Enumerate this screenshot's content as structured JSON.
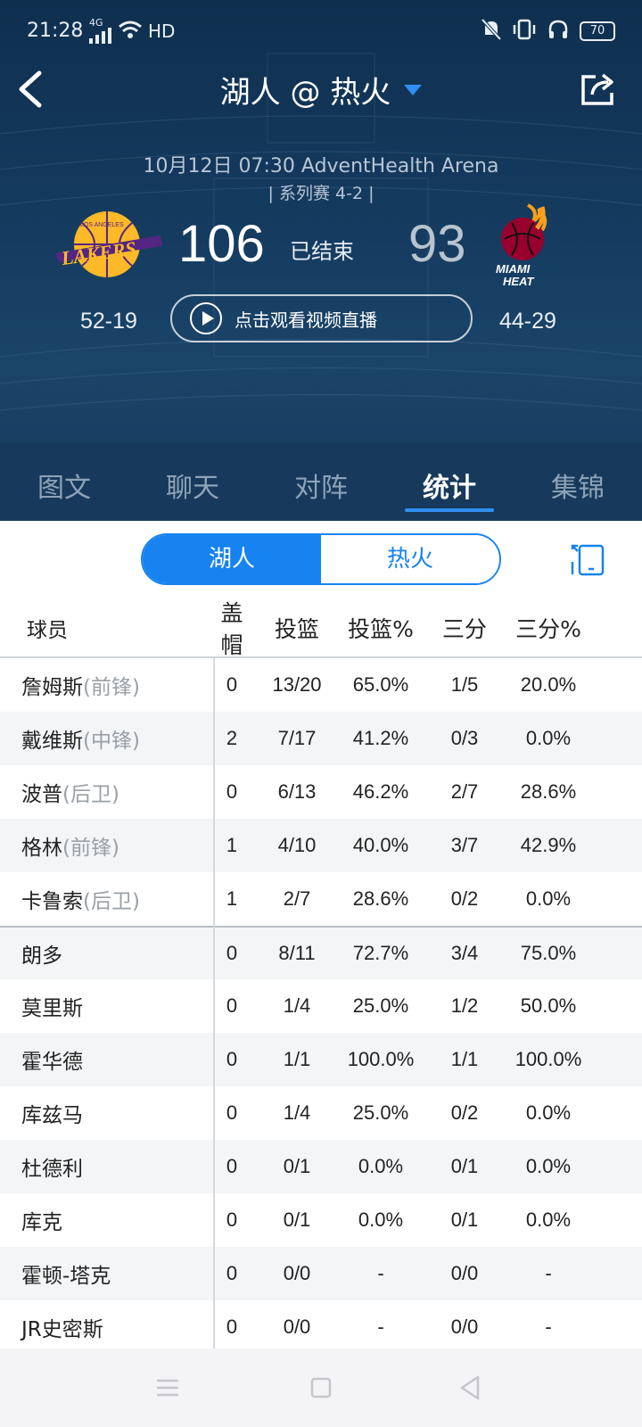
{
  "status_bar": {
    "time": "21:28",
    "network": "4G",
    "hd": "HD",
    "battery": "70"
  },
  "header": {
    "title": "湖人 @ 热火",
    "game_info": "10月12日 07:30 AdventHealth Arena",
    "series_info": "| 系列赛 4-2 |",
    "home": {
      "score": "106",
      "record": "52-19",
      "logo_text_top": "LOS ANGELES",
      "logo_text": "LAKERS"
    },
    "away": {
      "score": "93",
      "record": "44-29",
      "logo_text_1": "MIAMI",
      "logo_text_2": "HEAT"
    },
    "status": "已结束",
    "watch_label": "点击观看视频直播"
  },
  "tabs": [
    {
      "label": "图文"
    },
    {
      "label": "聊天"
    },
    {
      "label": "对阵"
    },
    {
      "label": "统计"
    },
    {
      "label": "集锦"
    }
  ],
  "active_tab": "统计",
  "team_toggle": {
    "team_a": "湖人",
    "team_b": "热火",
    "selected": "湖人"
  },
  "table": {
    "columns": [
      "球员",
      "盖帽",
      "投篮",
      "投篮%",
      "三分",
      "三分%"
    ],
    "rows": [
      {
        "name": "詹姆斯",
        "pos": "(前锋)",
        "blk": "0",
        "fg": "13/20",
        "fgp": "65.0%",
        "tp": "1/5",
        "tpp": "20.0%"
      },
      {
        "name": "戴维斯",
        "pos": "(中锋)",
        "blk": "2",
        "fg": "7/17",
        "fgp": "41.2%",
        "tp": "0/3",
        "tpp": "0.0%"
      },
      {
        "name": "波普",
        "pos": "(后卫)",
        "blk": "0",
        "fg": "6/13",
        "fgp": "46.2%",
        "tp": "2/7",
        "tpp": "28.6%"
      },
      {
        "name": "格林",
        "pos": "(前锋)",
        "blk": "1",
        "fg": "4/10",
        "fgp": "40.0%",
        "tp": "3/7",
        "tpp": "42.9%"
      },
      {
        "name": "卡鲁索",
        "pos": "(后卫)",
        "blk": "1",
        "fg": "2/7",
        "fgp": "28.6%",
        "tp": "0/2",
        "tpp": "0.0%"
      },
      {
        "name": "朗多",
        "pos": "",
        "blk": "0",
        "fg": "8/11",
        "fgp": "72.7%",
        "tp": "3/4",
        "tpp": "75.0%"
      },
      {
        "name": "莫里斯",
        "pos": "",
        "blk": "0",
        "fg": "1/4",
        "fgp": "25.0%",
        "tp": "1/2",
        "tpp": "50.0%"
      },
      {
        "name": "霍华德",
        "pos": "",
        "blk": "0",
        "fg": "1/1",
        "fgp": "100.0%",
        "tp": "1/1",
        "tpp": "100.0%"
      },
      {
        "name": "库兹马",
        "pos": "",
        "blk": "0",
        "fg": "1/4",
        "fgp": "25.0%",
        "tp": "0/2",
        "tpp": "0.0%"
      },
      {
        "name": "杜德利",
        "pos": "",
        "blk": "0",
        "fg": "0/1",
        "fgp": "0.0%",
        "tp": "0/1",
        "tpp": "0.0%"
      },
      {
        "name": "库克",
        "pos": "",
        "blk": "0",
        "fg": "0/1",
        "fgp": "0.0%",
        "tp": "0/1",
        "tpp": "0.0%"
      },
      {
        "name": "霍顿-塔克",
        "pos": "",
        "blk": "0",
        "fg": "0/0",
        "fgp": "-",
        "tp": "0/0",
        "tpp": "-"
      },
      {
        "name": "JR史密斯",
        "pos": "",
        "blk": "0",
        "fg": "0/0",
        "fgp": "-",
        "tp": "0/0",
        "tpp": "-"
      }
    ]
  },
  "colors": {
    "accent": "#1683f0",
    "header_bg": "#153c60",
    "position_text": "#9aa0a6"
  }
}
